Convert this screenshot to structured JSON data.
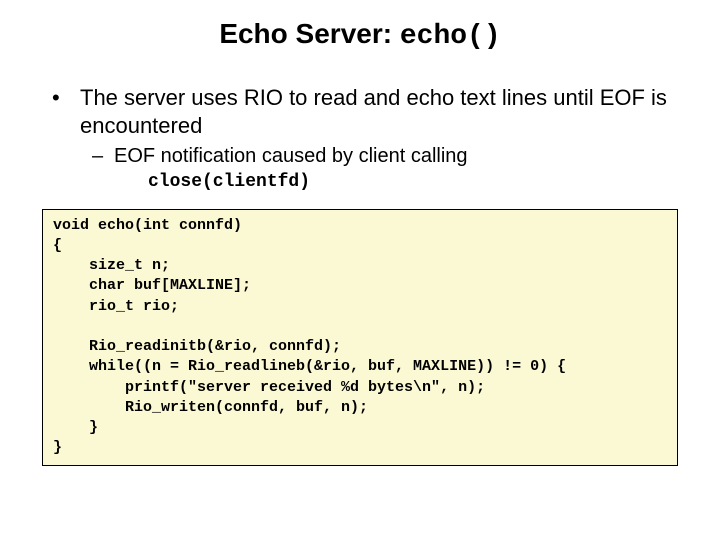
{
  "title_prefix": "Echo Server: ",
  "title_func": "echo()",
  "bullets": {
    "main": "The server uses RIO to read and echo text lines until EOF is encountered",
    "sub": "EOF notification caused by client calling",
    "sub_code": "close(clientfd)"
  },
  "code": "void echo(int connfd)\n{\n    size_t n;\n    char buf[MAXLINE];\n    rio_t rio;\n\n    Rio_readinitb(&rio, connfd);\n    while((n = Rio_readlineb(&rio, buf, MAXLINE)) != 0) {\n        printf(\"server received %d bytes\\n\", n);\n        Rio_writen(connfd, buf, n);\n    }\n}"
}
